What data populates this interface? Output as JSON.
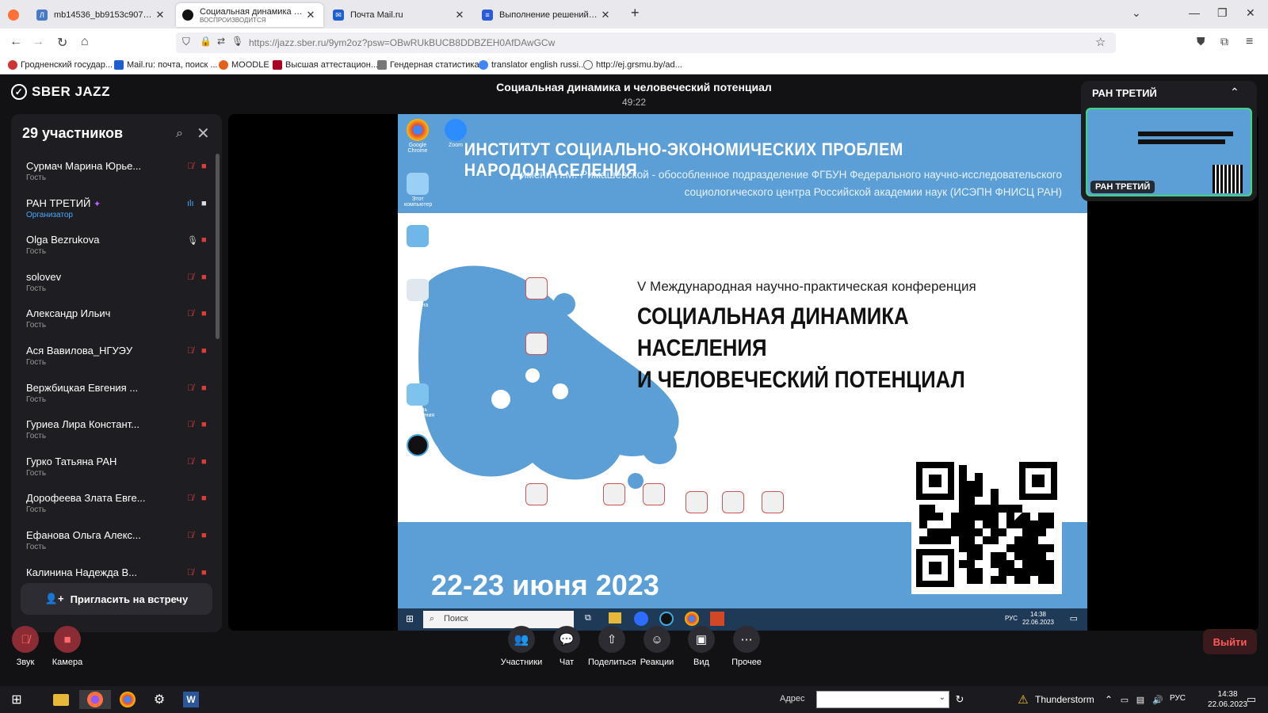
{
  "browser": {
    "tabs": [
      {
        "title": "mb14536_bb9153c907ad545a68",
        "subtitle": ""
      },
      {
        "title": "Социальная динамика и чело",
        "subtitle": "ВОСПРОИЗВОДИТСЯ"
      },
      {
        "title": "Почта Mail.ru",
        "subtitle": ""
      },
      {
        "title": "Выполнение решений УМО_2",
        "subtitle": ""
      }
    ],
    "url": "https://jazz.sber.ru/9ym2oz?psw=OBwRUkBUCB8DDBZEH0AfDAwGCw",
    "bookmarks": [
      "Гродненский государ...",
      "Mail.ru: почта, поиск ...",
      "MOODLE",
      "Высшая аттестацион...",
      "Гендерная статистика",
      "translator english russi...",
      "http://ej.grsmu.by/ad..."
    ]
  },
  "app": {
    "logo": "SBER JAZZ",
    "meeting_title": "Социальная динамика и человеческий потенциал",
    "timer": "49:22"
  },
  "participants": {
    "title": "29 участников",
    "list": [
      {
        "name": "Сурмач Марина Юрье...",
        "role": "Гость",
        "mic": "off",
        "cam": "off"
      },
      {
        "name": "РАН ТРЕТИЙ",
        "role": "Организатор",
        "mic": "on",
        "cam": "on"
      },
      {
        "name": "Olga Bezrukova",
        "role": "Гость",
        "mic": "on",
        "cam": "off"
      },
      {
        "name": "solovev",
        "role": "Гость",
        "mic": "off",
        "cam": "off"
      },
      {
        "name": "Александр Ильич",
        "role": "Гость",
        "mic": "off",
        "cam": "off"
      },
      {
        "name": "Ася Вавилова_НГУЭУ",
        "role": "Гость",
        "mic": "off",
        "cam": "off"
      },
      {
        "name": "Вержбицкая Евгения ...",
        "role": "Гость",
        "mic": "off",
        "cam": "off"
      },
      {
        "name": "Гуриеа Лира Констант...",
        "role": "Гость",
        "mic": "off",
        "cam": "off"
      },
      {
        "name": "Гурко Татьяна РАН",
        "role": "Гость",
        "mic": "off",
        "cam": "off"
      },
      {
        "name": "Дорофеева Злата Евге...",
        "role": "Гость",
        "mic": "off",
        "cam": "off"
      },
      {
        "name": "Ефанова Ольга Алекс...",
        "role": "Гость",
        "mic": "off",
        "cam": "off"
      },
      {
        "name": "Калинина Надежда В...",
        "role": "",
        "mic": "off",
        "cam": "off"
      }
    ],
    "invite_label": "Пригласить на встречу"
  },
  "shared_screen": {
    "institute_title": "ИНСТИТУТ СОЦИАЛЬНО-ЭКОНОМИЧЕСКИХ ПРОБЛЕМ НАРОДОНАСЕЛЕНИЯ",
    "institute_sub": "имени Н.М. Римашевской - обособленное подразделение ФГБУН Федерального научно-исследовательского социологического центра  Российской академии наук (ИСЭПН ФНИСЦ РАН)",
    "conference_line1": "V Международная научно-практическая конференция",
    "conference_line2": "СОЦИАЛЬНАЯ ДИНАМИКА НАСЕЛЕНИЯ",
    "conference_line3": "И ЧЕЛОВЕЧЕСКИЙ ПОТЕНЦИАЛ",
    "dates": "22-23 июня 2023",
    "desktop_icons": [
      "Google Chrome",
      "Zoom",
      "Этот компьютер",
      "Сеть",
      "Корзина",
      "Панель управления"
    ],
    "taskbar_search": "Поиск",
    "taskbar_lang": "РУС",
    "taskbar_time": "14:38",
    "taskbar_date": "22.06.2023"
  },
  "preview": {
    "name": "РАН ТРЕТИЙ",
    "label": "РАН ТРЕТИЙ"
  },
  "controls": {
    "sound": "Звук",
    "camera": "Камера",
    "participants": "Участники",
    "chat": "Чат",
    "share": "Поделиться",
    "reactions": "Реакции",
    "view": "Вид",
    "more": "Прочее",
    "exit": "Выйти"
  },
  "windows_taskbar": {
    "address_label": "Адрес",
    "weather": "Thunderstorm",
    "lang": "РУС",
    "time": "14:38",
    "date": "22.06.2023"
  },
  "colors": {
    "jazz_bg": "#121214",
    "panel": "#1e1e22",
    "accent_red": "#e03b3b",
    "slide_blue": "#5b9fd6",
    "active_green": "#3ed67a"
  }
}
